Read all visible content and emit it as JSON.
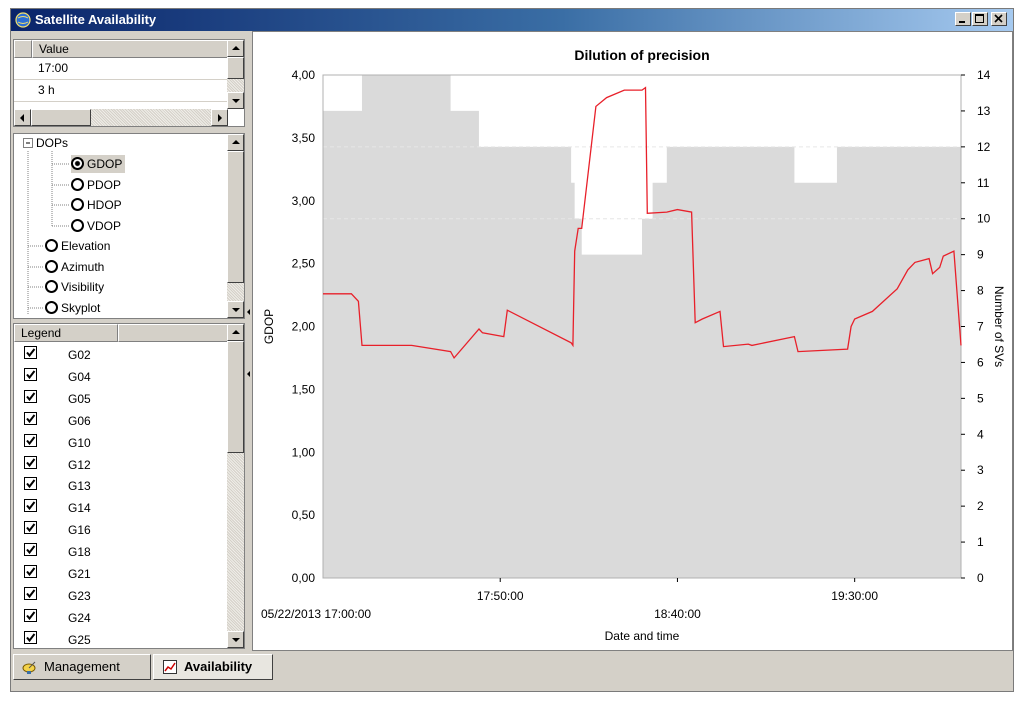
{
  "window": {
    "title": "Satellite Availability"
  },
  "props": {
    "header": "Value",
    "rows": [
      "17:00",
      "3 h"
    ]
  },
  "tree": {
    "root": "DOPs",
    "children": [
      {
        "label": "GDOP",
        "selected": true
      },
      {
        "label": "PDOP",
        "selected": false
      },
      {
        "label": "HDOP",
        "selected": false
      },
      {
        "label": "VDOP",
        "selected": false
      }
    ],
    "others": [
      "Elevation",
      "Azimuth",
      "Visibility",
      "Skyplot"
    ]
  },
  "legend": {
    "header": "Legend",
    "items": [
      "G02",
      "G04",
      "G05",
      "G06",
      "G10",
      "G12",
      "G13",
      "G14",
      "G16",
      "G18",
      "G21",
      "G23",
      "G24",
      "G25"
    ]
  },
  "tabs": {
    "management": "Management",
    "availability": "Availability"
  },
  "icons": {
    "app": "satellite-globe-icon",
    "management": "satellite-dish-icon",
    "availability": "chart-icon"
  },
  "chart_data": {
    "type": "line",
    "title": "Dilution of precision",
    "xlabel": "Date and time",
    "ylabel": "GDOP",
    "y2label": "Number of SVs",
    "start_label": "05/22/2013 17:00:00",
    "x_ticks": [
      "17:50:00",
      "18:40:00",
      "19:30:00"
    ],
    "x_tick_minutes": [
      50,
      100,
      150
    ],
    "x_range_minutes": [
      0,
      180
    ],
    "ylim": [
      0,
      4
    ],
    "y_ticks": [
      "0,00",
      "0,50",
      "1,00",
      "1,50",
      "2,00",
      "2,50",
      "3,00",
      "3,50",
      "4,00"
    ],
    "y2lim": [
      0,
      14
    ],
    "y2_ticks": [
      "0",
      "1",
      "2",
      "3",
      "4",
      "5",
      "6",
      "7",
      "8",
      "9",
      "10",
      "11",
      "12",
      "13",
      "14"
    ],
    "colors": {
      "gdop": "#e8202a",
      "svs": "#dadada"
    },
    "series": [
      {
        "name": "GDOP",
        "x_minutes": [
          0,
          8,
          10,
          11,
          25,
          36,
          37,
          44,
          45,
          51,
          52,
          70,
          70.5,
          71,
          72,
          73,
          77,
          80,
          85,
          90,
          91,
          91.5,
          97,
          100,
          104,
          105,
          107,
          112,
          113,
          120,
          121,
          133,
          134,
          148,
          149,
          150,
          155,
          162,
          165,
          167,
          171,
          172,
          174,
          175,
          178,
          180
        ],
        "values": [
          2.26,
          2.26,
          2.2,
          1.85,
          1.85,
          1.8,
          1.75,
          1.98,
          1.95,
          1.92,
          2.13,
          1.87,
          1.85,
          2.6,
          2.78,
          2.78,
          3.75,
          3.82,
          3.88,
          3.88,
          3.9,
          2.9,
          2.91,
          2.93,
          2.91,
          2.03,
          2.06,
          2.12,
          1.84,
          1.86,
          1.85,
          1.92,
          1.8,
          1.82,
          2.0,
          2.06,
          2.12,
          2.3,
          2.45,
          2.51,
          2.54,
          2.42,
          2.47,
          2.56,
          2.6,
          1.85
        ]
      },
      {
        "name": "Number of SVs",
        "x_minutes": [
          0,
          11,
          11,
          36,
          36,
          44,
          44,
          70,
          70,
          71,
          71,
          73,
          73,
          90,
          90,
          93,
          93,
          97,
          97,
          106,
          106,
          133,
          133,
          145,
          145,
          148,
          148,
          162,
          162,
          180
        ],
        "values": [
          13,
          13,
          14,
          14,
          13,
          13,
          12,
          12,
          11,
          11,
          10,
          10,
          9,
          9,
          10,
          10,
          11,
          11,
          12,
          12,
          12,
          12,
          11,
          11,
          12,
          12,
          12,
          12,
          12,
          12
        ]
      }
    ]
  }
}
